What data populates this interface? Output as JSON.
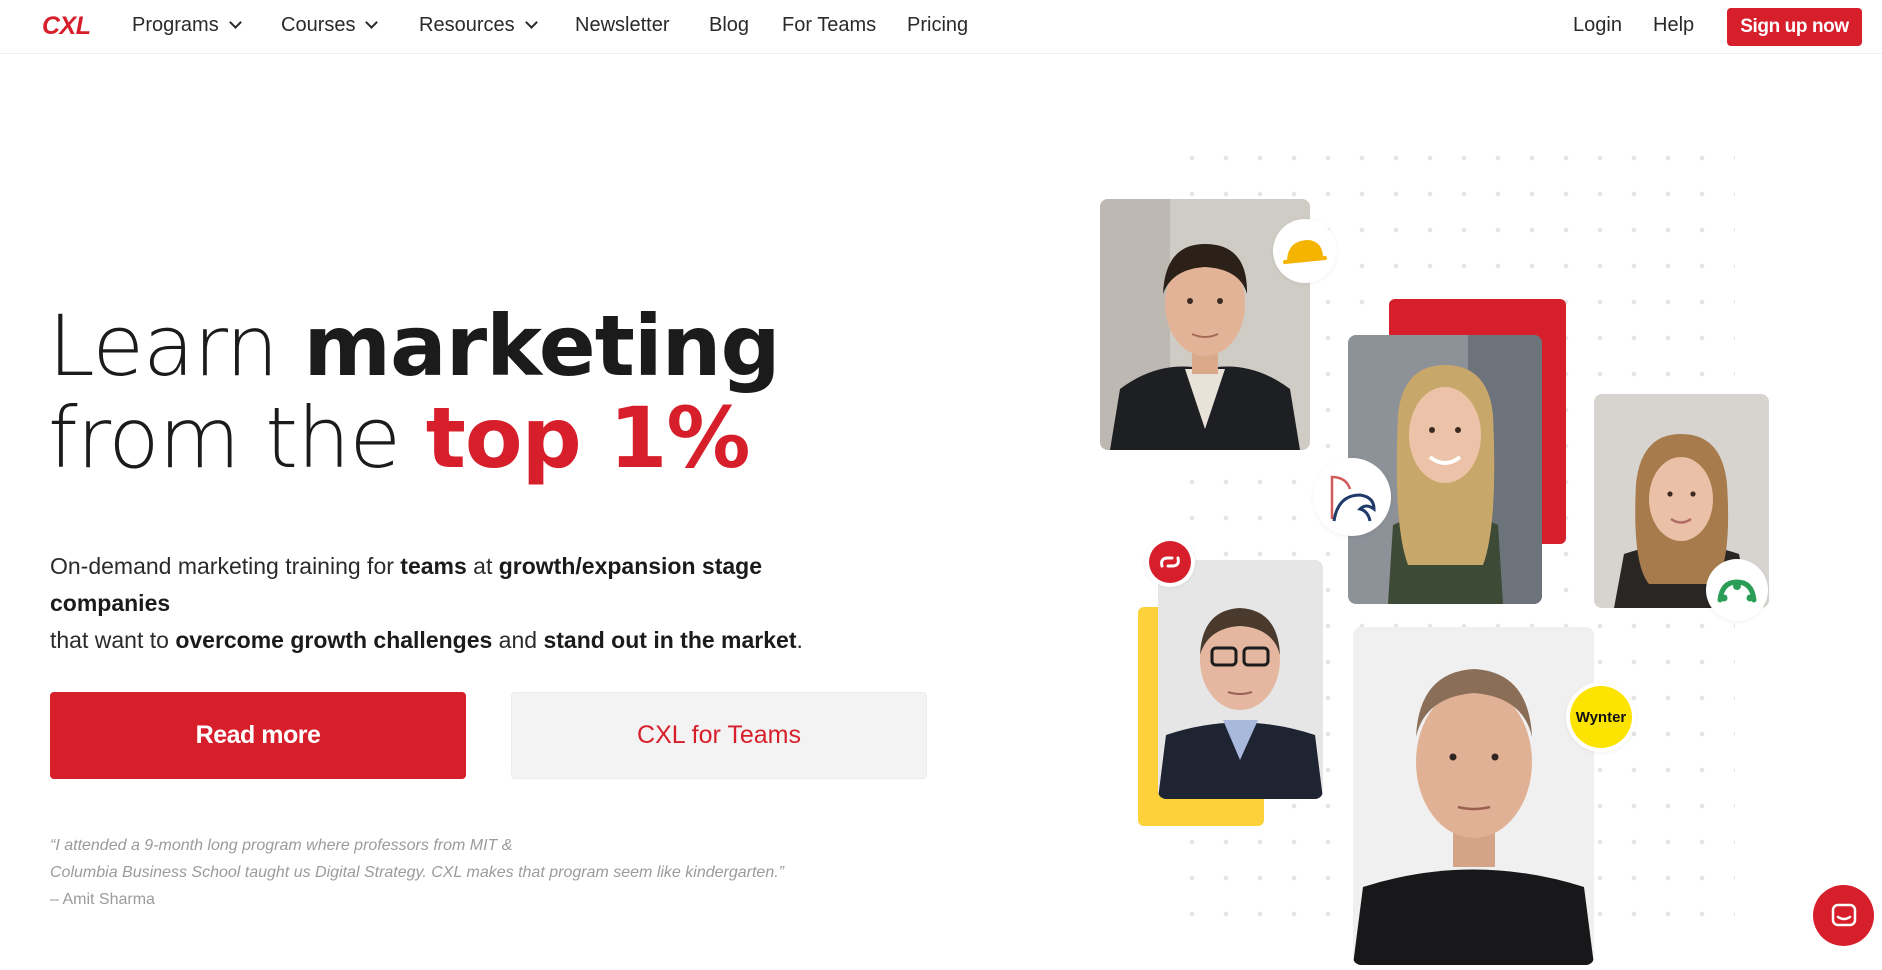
{
  "nav": {
    "logo": "CXL",
    "items": [
      {
        "label": "Programs",
        "dropdown": true
      },
      {
        "label": "Courses",
        "dropdown": true
      },
      {
        "label": "Resources",
        "dropdown": true
      },
      {
        "label": "Newsletter",
        "dropdown": false
      },
      {
        "label": "Blog",
        "dropdown": false
      },
      {
        "label": "For Teams",
        "dropdown": false
      },
      {
        "label": "Pricing",
        "dropdown": false
      }
    ],
    "login": "Login",
    "help": "Help",
    "signup": "Sign up now"
  },
  "hero": {
    "headline": {
      "line1_light": "Learn ",
      "line1_bold": "marketing",
      "line2_light": "from the ",
      "line2_red": "top 1%"
    },
    "lead": {
      "p1": "On-demand marketing training for ",
      "b1": "teams",
      "p2": " at ",
      "b2": "growth/expansion stage companies",
      "p3": "that want to ",
      "b3": "overcome growth challenges",
      "p4": " and ",
      "b4": "stand out in the market",
      "p5": "."
    },
    "primary_button": "Read more",
    "secondary_button": "CXL for Teams",
    "quote": {
      "line1": "“I attended a 9-month long program where professors from MIT &",
      "line2": "Columbia Business School taught us Digital Strategy. CXL makes that program seem like kindergarten.”",
      "author": "– Amit Sharma"
    }
  },
  "collage": {
    "badge_wynter": "Wynter"
  },
  "colors": {
    "brand_red": "#d71f2b",
    "accent_yellow": "#fcd13a",
    "text_dark": "#1b1b1b",
    "text_muted": "#9b9b9b"
  },
  "icons": {
    "chat": "chat-bubble-icon",
    "chevron": "chevron-down-icon"
  }
}
